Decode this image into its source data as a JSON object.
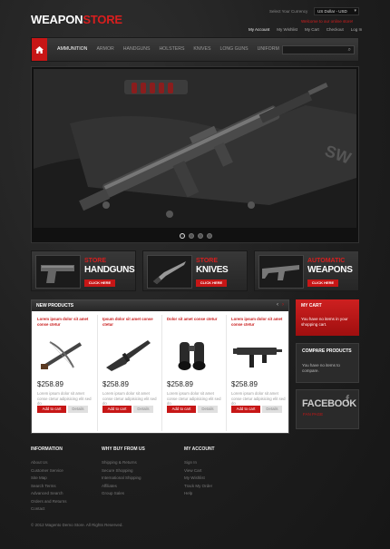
{
  "logo": {
    "part1": "WEAPON",
    "part2": "STORE"
  },
  "header": {
    "currency_label": "Select Your Currency",
    "currency_value": "US Dollar - USD",
    "welcome": "Welcome to our online store!",
    "links": [
      "My Account",
      "My Wishlist",
      "My Cart",
      "Checkout",
      "Log In"
    ]
  },
  "nav": {
    "items": [
      "AMMUNITION",
      "ARMOR",
      "HANDGUNS",
      "HOLSTERS",
      "KNIVES",
      "LONG GUNS",
      "UNIFORM"
    ]
  },
  "slider": {
    "pages": 4,
    "active": 0
  },
  "banners": [
    {
      "line1": "STORE",
      "line2": "HANDGUNS",
      "button": "CLICK HERE"
    },
    {
      "line1": "STORE",
      "line2": "KNIVES",
      "button": "CLICK HERE"
    },
    {
      "line1": "AUTOMATIC",
      "line2": "WEAPONS",
      "button": "CLICK HERE"
    }
  ],
  "new_products": {
    "title": "NEW PRODUCTS",
    "items": [
      {
        "title": "Lorem ipsum dolor sit amet conse ctetur",
        "price": "$258.89",
        "desc": "Lorem ipsum dolor sit amet conse ctetur adipisicing elit sed do",
        "add": "Add to cart",
        "details": "Details"
      },
      {
        "title": "Ipsum dolor sit amet conse ctetur",
        "price": "$258.89",
        "desc": "Lorem ipsum dolor sit amet conse ctetur adipisicing elit sed do",
        "add": "Add to cart",
        "details": "Details"
      },
      {
        "title": "Dolor sit amet conse ctetur",
        "price": "$258.89",
        "desc": "Lorem ipsum dolor sit amet conse ctetur adipisicing elit sed do",
        "add": "Add to cart",
        "details": "Details"
      },
      {
        "title": "Lorem ipsum dolor sit amet conse ctetur",
        "price": "$258.89",
        "desc": "Lorem ipsum dolor sit amet conse ctetur adipisicing elit sed do",
        "add": "Add to cart",
        "details": "Details"
      }
    ]
  },
  "sidebar": {
    "cart_title": "MY CART",
    "cart_text": "You have no items in your shopping cart.",
    "compare_title": "COMPARE PRODUCTS",
    "compare_text": "You have no items to compare.",
    "fb_title": "FACEBOOK",
    "fb_sub": "FAN PAGE"
  },
  "footer": {
    "col1_title": "INFORMATION",
    "col1": [
      "About Us",
      "Customer Service",
      "Site Map",
      "Search Terms",
      "Advanced Search",
      "Orders and Returns",
      "Contact"
    ],
    "col2_title": "WHY BUY FROM US",
    "col2": [
      "Shipping & Returns",
      "Secure Shopping",
      "International Shipping",
      "Affiliates",
      "Group Sales"
    ],
    "col3_title": "MY ACCOUNT",
    "col3": [
      "Sign In",
      "View Cart",
      "My Wishlist",
      "Track My Order",
      "Help"
    ],
    "copyright": "© 2012 Magento Demo Store. All Rights Reserved."
  }
}
